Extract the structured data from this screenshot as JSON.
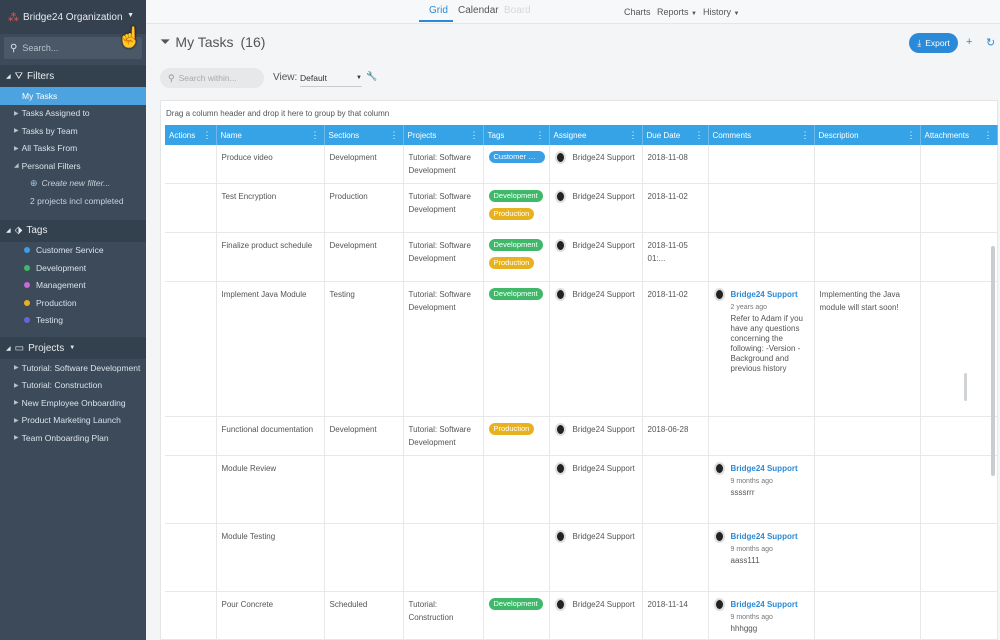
{
  "org": {
    "name": "Bridge24 Organization"
  },
  "sidebar": {
    "search_placeholder": "Search...",
    "filters": {
      "title": "Filters",
      "items": [
        {
          "label": "My Tasks"
        },
        {
          "label": "Tasks Assigned to"
        },
        {
          "label": "Tasks by Team"
        },
        {
          "label": "All Tasks From"
        },
        {
          "label": "Personal Filters"
        }
      ],
      "create_new": "Create new filter...",
      "projects_note": "2 projects incl completed"
    },
    "tags": {
      "title": "Tags",
      "items": [
        {
          "label": "Customer Service",
          "color": "#3aa0e6"
        },
        {
          "label": "Development",
          "color": "#3fb86a"
        },
        {
          "label": "Management",
          "color": "#c86ad6"
        },
        {
          "label": "Production",
          "color": "#e8b21f"
        },
        {
          "label": "Testing",
          "color": "#6a63d8"
        }
      ]
    },
    "projects": {
      "title": "Projects",
      "items": [
        {
          "label": "Tutorial: Software Development"
        },
        {
          "label": "Tutorial: Construction"
        },
        {
          "label": "New Employee Onboarding"
        },
        {
          "label": "Product Marketing Launch"
        },
        {
          "label": "Team Onboarding Plan"
        }
      ]
    }
  },
  "topbar": {
    "tabs": [
      {
        "label": "Grid"
      },
      {
        "label": "Calendar"
      },
      {
        "label": "Board"
      }
    ],
    "menus": [
      {
        "label": "Charts"
      },
      {
        "label": "Reports"
      },
      {
        "label": "History"
      }
    ]
  },
  "page": {
    "title": "My Tasks",
    "count": "(16)",
    "export_label": "Export",
    "search_placeholder": "Search within...",
    "view_label": "View:",
    "view_value": "Default"
  },
  "grid": {
    "group_hint": "Drag a column header and drop it here to group by that column",
    "columns": [
      "Actions",
      "Name",
      "Sections",
      "Projects",
      "Tags",
      "Assignee",
      "Due Date",
      "Comments",
      "Description",
      "Attachments"
    ],
    "rows": [
      {
        "name": "Produce video",
        "section": "Development",
        "project": "Tutorial: Software Development",
        "tags": [
          {
            "label": "Customer Ser...",
            "color": "#3aa0e6"
          }
        ],
        "assignee": "Bridge24 Support",
        "due": "2018-11-08",
        "comment": null,
        "description": ""
      },
      {
        "name": "Test Encryption",
        "section": "Production",
        "project": "Tutorial: Software Development",
        "tags": [
          {
            "label": "Development",
            "color": "#3fb86a"
          },
          {
            "label": "Production",
            "color": "#e8b21f"
          }
        ],
        "assignee": "Bridge24 Support",
        "due": "2018-11-02",
        "comment": null,
        "description": ""
      },
      {
        "name": "Finalize product schedule",
        "section": "Development",
        "project": "Tutorial: Software Development",
        "tags": [
          {
            "label": "Development",
            "color": "#3fb86a"
          },
          {
            "label": "Production",
            "color": "#e8b21f"
          }
        ],
        "assignee": "Bridge24 Support",
        "due": "2018-11-05 01:...",
        "comment": null,
        "description": ""
      },
      {
        "name": "Implement Java Module",
        "section": "Testing",
        "project": "Tutorial: Software Development",
        "tags": [
          {
            "label": "Development",
            "color": "#3fb86a"
          }
        ],
        "assignee": "Bridge24 Support",
        "due": "2018-11-02",
        "comment": {
          "author": "Bridge24 Support",
          "time": "2 years ago",
          "text": "Refer to Adam if you have any questions concerning the following: -Version -Background and previous history"
        },
        "description": "Implementing the Java module will start soon!"
      },
      {
        "name": "Functional documentation",
        "section": "Development",
        "project": "Tutorial: Software Development",
        "tags": [
          {
            "label": "Production",
            "color": "#e8b21f"
          }
        ],
        "assignee": "Bridge24 Support",
        "due": "2018-06-28",
        "comment": null,
        "description": ""
      },
      {
        "name": "Module Review",
        "section": "",
        "project": "",
        "tags": [],
        "assignee": "Bridge24 Support",
        "due": "",
        "comment": {
          "author": "Bridge24 Support",
          "time": "9 months ago",
          "text": "ssssrrr"
        },
        "description": ""
      },
      {
        "name": "Module Testing",
        "section": "",
        "project": "",
        "tags": [],
        "assignee": "Bridge24 Support",
        "due": "",
        "comment": {
          "author": "Bridge24 Support",
          "time": "9 months ago",
          "text": "aass111"
        },
        "description": ""
      },
      {
        "name": "Pour Concrete",
        "section": "Scheduled",
        "project": "Tutorial: Construction",
        "tags": [
          {
            "label": "Development",
            "color": "#3fb86a"
          }
        ],
        "assignee": "Bridge24 Support",
        "due": "2018-11-14",
        "comment": {
          "author": "Bridge24 Support",
          "time": "9 months ago",
          "text": "hhhggg"
        },
        "description": ""
      }
    ]
  }
}
